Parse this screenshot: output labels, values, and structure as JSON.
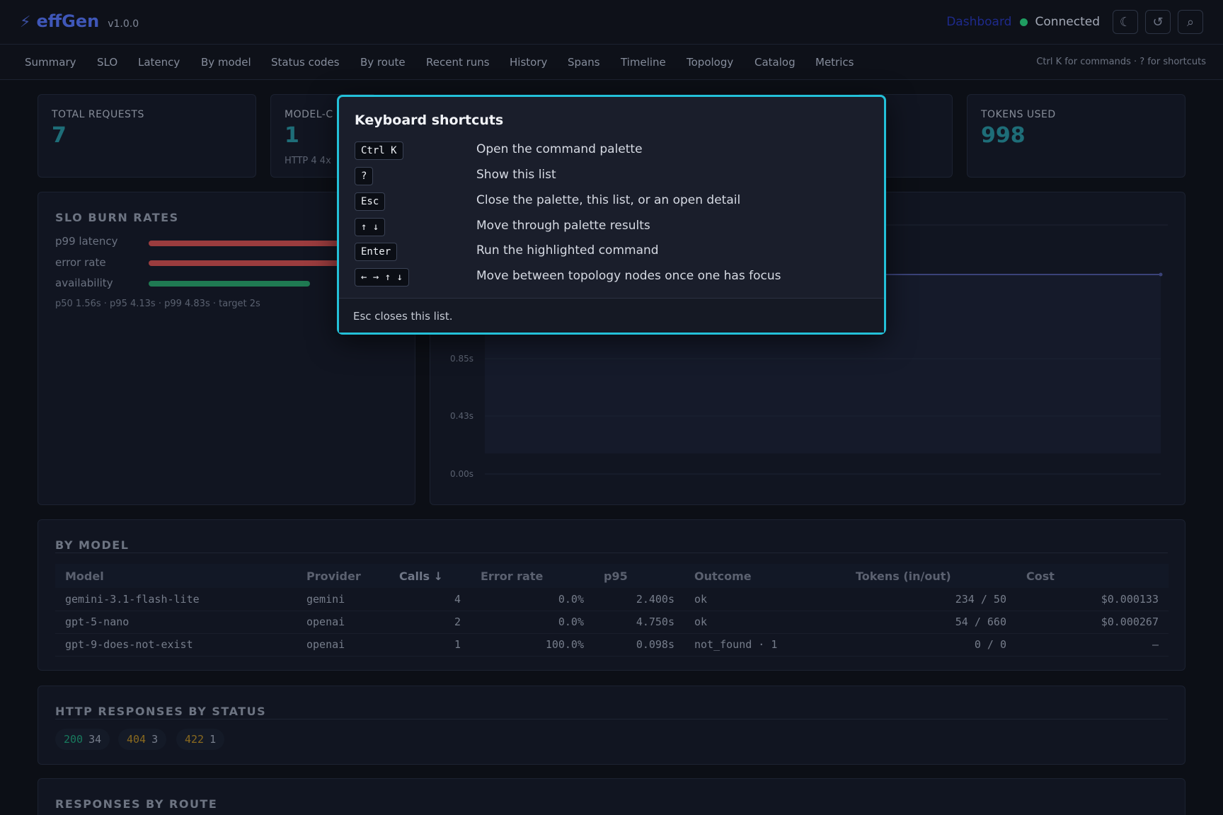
{
  "header": {
    "brand_icon": "bolt-icon",
    "brand_name": "effGen",
    "version": "v1.0.0",
    "dashboard_link": "Dashboard",
    "status_text": "Connected",
    "status_color": "#1f9d61",
    "accent_color": "#23c0d8",
    "actions": [
      {
        "name": "theme-toggle",
        "icon": "moon-icon",
        "glyph": "☾"
      },
      {
        "name": "refresh",
        "icon": "refresh-icon",
        "glyph": "↺"
      },
      {
        "name": "search",
        "icon": "search-icon",
        "glyph": "⌕"
      }
    ]
  },
  "tabs": [
    "Summary",
    "SLO",
    "Latency",
    "By model",
    "Status codes",
    "By route",
    "Recent runs",
    "History",
    "Spans",
    "Timeline",
    "Topology",
    "Catalog",
    "Metrics"
  ],
  "tab_hint": "Ctrl K for commands · ? for shortcuts",
  "kpis": [
    {
      "label": "TOTAL REQUESTS",
      "value": "7",
      "sub": ""
    },
    {
      "label": "MODEL-C",
      "value": "1",
      "sub": "HTTP 4 4x"
    },
    {
      "label": "TOKENS USED",
      "value": "998",
      "sub": ""
    }
  ],
  "slo": {
    "title": "SLO BURN RATES",
    "rows": [
      {
        "label": "p99 latency",
        "color": "#9b3c3e"
      },
      {
        "label": "error rate",
        "color": "#9b3c3e"
      },
      {
        "label": "availability",
        "color": "#1f7a52",
        "level_fraction": 0.85
      }
    ],
    "note": "p50 1.56s · p95 4.13s · p99 4.83s · target 2s"
  },
  "latency_chart": {
    "y_ticks": [
      "0.85s",
      "0.43s",
      "0.00s"
    ]
  },
  "by_model": {
    "title": "BY MODEL",
    "columns": [
      "Model",
      "Provider",
      "Calls ↓",
      "Error rate",
      "p95",
      "Outcome",
      "Tokens (in/out)",
      "Cost"
    ],
    "rows": [
      {
        "model": "gemini-3.1-flash-lite",
        "provider": "gemini",
        "calls": "4",
        "error_rate": "0.0%",
        "p95": "2.400s",
        "outcome": "ok",
        "tokens": "234 / 50",
        "cost": "$0.000133"
      },
      {
        "model": "gpt-5-nano",
        "provider": "openai",
        "calls": "2",
        "error_rate": "0.0%",
        "p95": "4.750s",
        "outcome": "ok",
        "tokens": "54 / 660",
        "cost": "$0.000267"
      },
      {
        "model": "gpt-9-does-not-exist",
        "provider": "openai",
        "calls": "1",
        "error_rate": "100.0%",
        "p95": "0.098s",
        "outcome": "not_found · 1",
        "tokens": "0 / 0",
        "cost": "–"
      }
    ]
  },
  "http_status": {
    "title": "HTTP RESPONSES BY STATUS",
    "items": [
      {
        "code": "200",
        "count": "34",
        "color": "#187a5e"
      },
      {
        "code": "404",
        "count": "3",
        "color": "#8a6a1f"
      },
      {
        "code": "422",
        "count": "1",
        "color": "#8a6a1f"
      }
    ]
  },
  "by_route": {
    "title": "RESPONSES BY ROUTE"
  },
  "shortcuts": {
    "title": "Keyboard shortcuts",
    "items": [
      {
        "keys": "Ctrl K",
        "desc": "Open the command palette"
      },
      {
        "keys": "?",
        "desc": "Show this list"
      },
      {
        "keys": "Esc",
        "desc": "Close the palette, this list, or an open detail"
      },
      {
        "keys": "↑ ↓",
        "desc": "Move through palette results"
      },
      {
        "keys": "Enter",
        "desc": "Run the highlighted command"
      },
      {
        "keys": "← → ↑ ↓",
        "desc": "Move between topology nodes once one has focus"
      }
    ],
    "footer": "Esc closes this list."
  }
}
